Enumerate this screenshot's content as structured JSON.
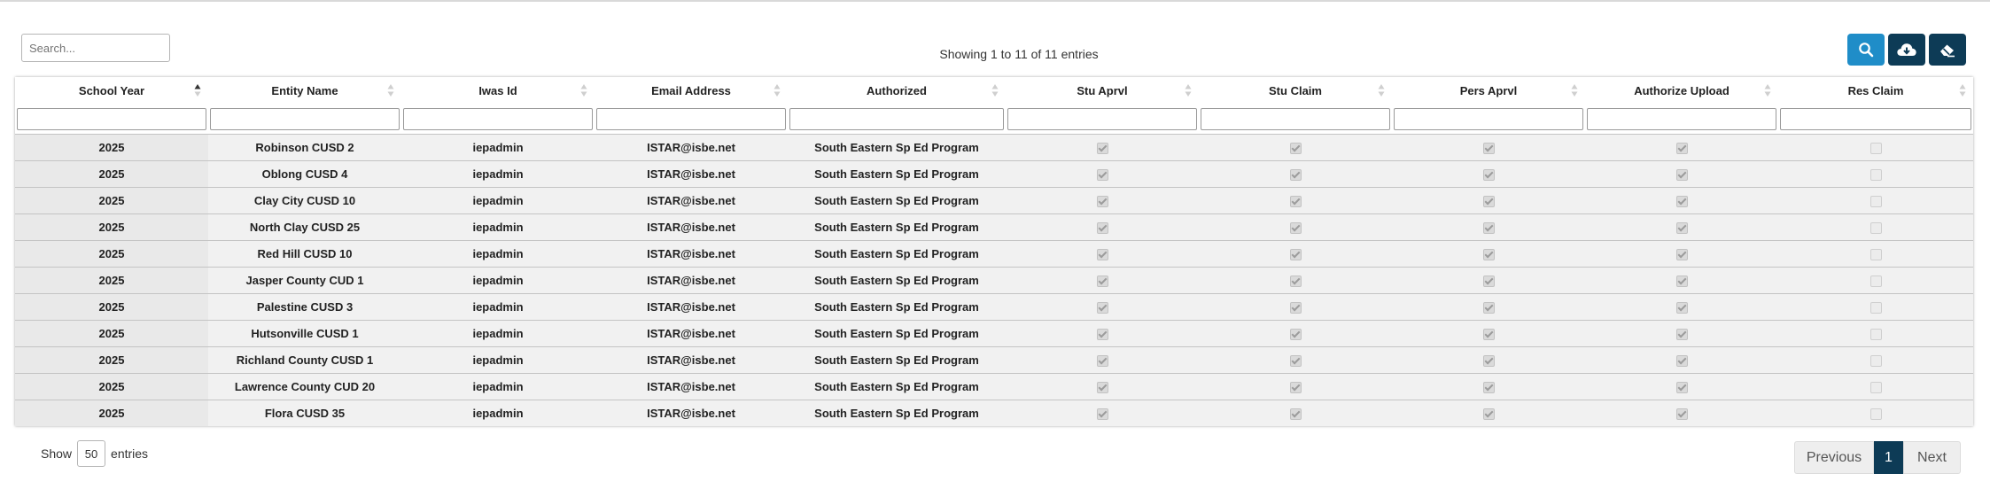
{
  "search": {
    "placeholder": "Search..."
  },
  "info_text": "Showing 1 to 11 of 11 entries",
  "toolbar": {
    "search_icon": "search-icon",
    "download_icon": "cloud-download-icon",
    "clear_icon": "eraser-icon"
  },
  "columns": [
    "School Year",
    "Entity Name",
    "Iwas Id",
    "Email Address",
    "Authorized",
    "Stu Aprvl",
    "Stu Claim",
    "Pers Aprvl",
    "Authorize Upload",
    "Res Claim"
  ],
  "rows": [
    {
      "year": "2025",
      "entity": "Robinson CUSD 2",
      "iwas": "iepadmin",
      "email": "ISTAR@isbe.net",
      "authorized": "South Eastern Sp Ed Program",
      "stu_aprvl": true,
      "stu_claim": true,
      "pers_aprvl": true,
      "auth_upload": true,
      "res_claim": false
    },
    {
      "year": "2025",
      "entity": "Oblong CUSD 4",
      "iwas": "iepadmin",
      "email": "ISTAR@isbe.net",
      "authorized": "South Eastern Sp Ed Program",
      "stu_aprvl": true,
      "stu_claim": true,
      "pers_aprvl": true,
      "auth_upload": true,
      "res_claim": false
    },
    {
      "year": "2025",
      "entity": "Clay City CUSD 10",
      "iwas": "iepadmin",
      "email": "ISTAR@isbe.net",
      "authorized": "South Eastern Sp Ed Program",
      "stu_aprvl": true,
      "stu_claim": true,
      "pers_aprvl": true,
      "auth_upload": true,
      "res_claim": false
    },
    {
      "year": "2025",
      "entity": "North Clay CUSD 25",
      "iwas": "iepadmin",
      "email": "ISTAR@isbe.net",
      "authorized": "South Eastern Sp Ed Program",
      "stu_aprvl": true,
      "stu_claim": true,
      "pers_aprvl": true,
      "auth_upload": true,
      "res_claim": false
    },
    {
      "year": "2025",
      "entity": "Red Hill CUSD 10",
      "iwas": "iepadmin",
      "email": "ISTAR@isbe.net",
      "authorized": "South Eastern Sp Ed Program",
      "stu_aprvl": true,
      "stu_claim": true,
      "pers_aprvl": true,
      "auth_upload": true,
      "res_claim": false
    },
    {
      "year": "2025",
      "entity": "Jasper County CUD 1",
      "iwas": "iepadmin",
      "email": "ISTAR@isbe.net",
      "authorized": "South Eastern Sp Ed Program",
      "stu_aprvl": true,
      "stu_claim": true,
      "pers_aprvl": true,
      "auth_upload": true,
      "res_claim": false
    },
    {
      "year": "2025",
      "entity": "Palestine CUSD 3",
      "iwas": "iepadmin",
      "email": "ISTAR@isbe.net",
      "authorized": "South Eastern Sp Ed Program",
      "stu_aprvl": true,
      "stu_claim": true,
      "pers_aprvl": true,
      "auth_upload": true,
      "res_claim": false
    },
    {
      "year": "2025",
      "entity": "Hutsonville CUSD 1",
      "iwas": "iepadmin",
      "email": "ISTAR@isbe.net",
      "authorized": "South Eastern Sp Ed Program",
      "stu_aprvl": true,
      "stu_claim": true,
      "pers_aprvl": true,
      "auth_upload": true,
      "res_claim": false
    },
    {
      "year": "2025",
      "entity": "Richland County CUSD 1",
      "iwas": "iepadmin",
      "email": "ISTAR@isbe.net",
      "authorized": "South Eastern Sp Ed Program",
      "stu_aprvl": true,
      "stu_claim": true,
      "pers_aprvl": true,
      "auth_upload": true,
      "res_claim": false
    },
    {
      "year": "2025",
      "entity": "Lawrence County CUD 20",
      "iwas": "iepadmin",
      "email": "ISTAR@isbe.net",
      "authorized": "South Eastern Sp Ed Program",
      "stu_aprvl": true,
      "stu_claim": true,
      "pers_aprvl": true,
      "auth_upload": true,
      "res_claim": false
    },
    {
      "year": "2025",
      "entity": "Flora CUSD 35",
      "iwas": "iepadmin",
      "email": "ISTAR@isbe.net",
      "authorized": "South Eastern Sp Ed Program",
      "stu_aprvl": true,
      "stu_claim": true,
      "pers_aprvl": true,
      "auth_upload": true,
      "res_claim": false
    }
  ],
  "length": {
    "show_label": "Show",
    "value": "50",
    "entries_label": "entries"
  },
  "pagination": {
    "previous": "Previous",
    "current": "1",
    "next": "Next"
  }
}
